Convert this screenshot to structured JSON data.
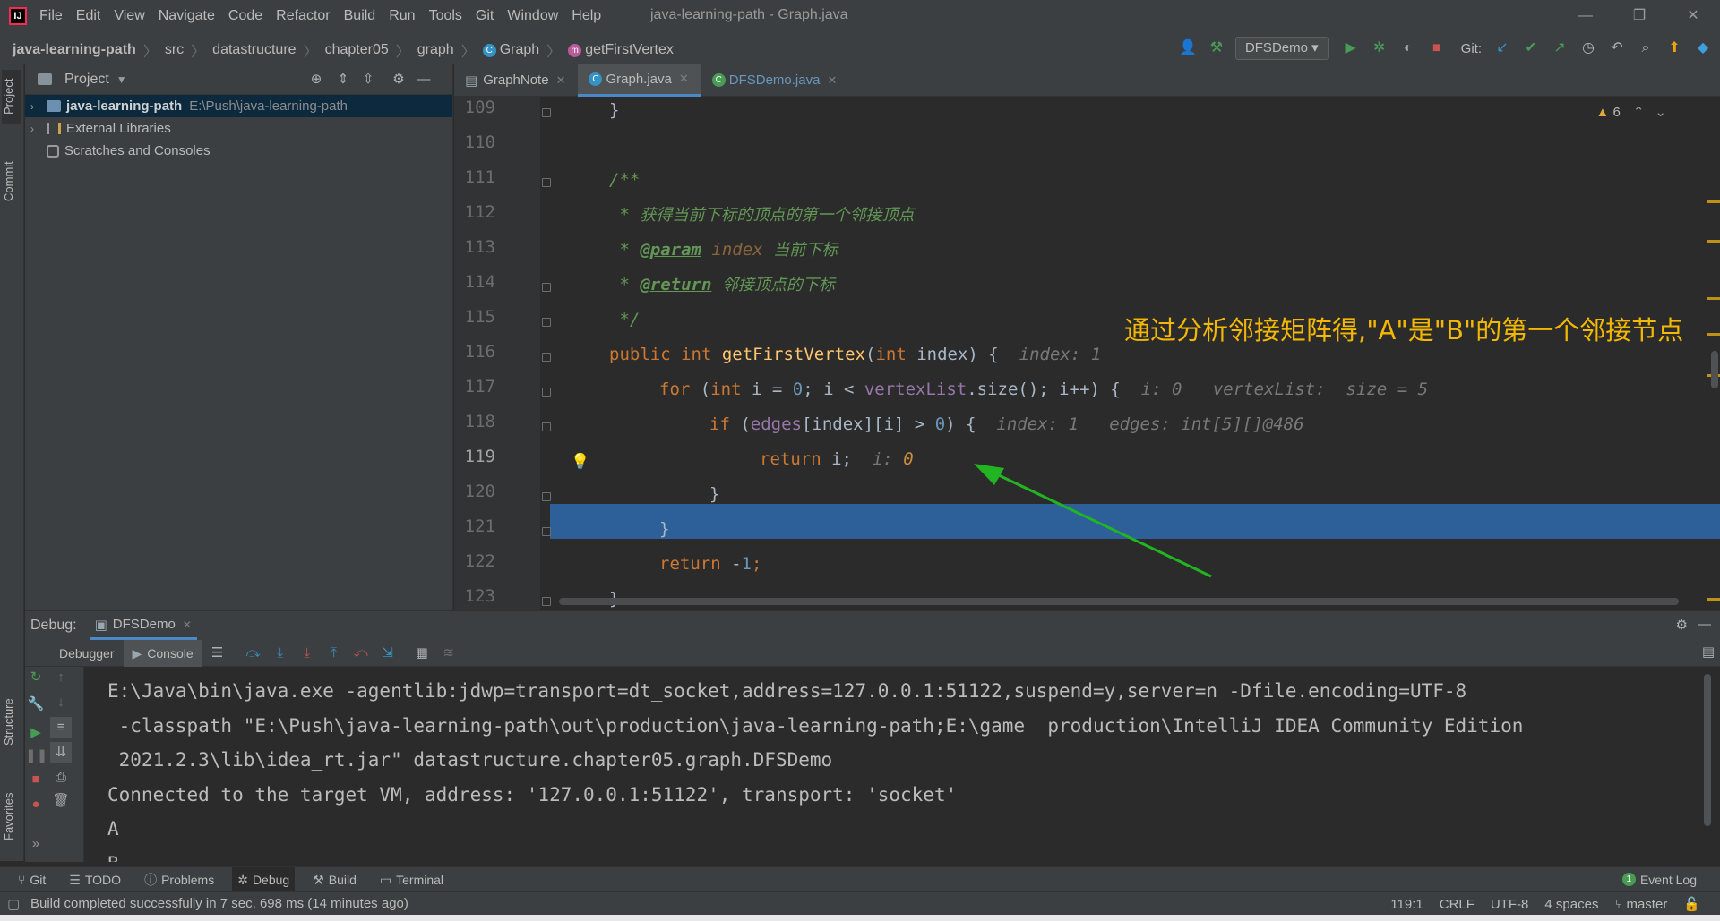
{
  "app": {
    "logo_text": "IJ",
    "window_title": "java-learning-path - Graph.java",
    "menu": [
      "File",
      "Edit",
      "View",
      "Navigate",
      "Code",
      "Refactor",
      "Build",
      "Run",
      "Tools",
      "Git",
      "Window",
      "Help"
    ],
    "window_controls": [
      "—",
      "❐",
      "✕"
    ]
  },
  "navbar": {
    "breadcrumb": {
      "project": "java-learning-path",
      "src": "src",
      "pkg1": "datastructure",
      "pkg2": "chapter05",
      "pkg3": "graph",
      "class": "Graph",
      "method": "getFirstVertex"
    },
    "run_config": "DFSDemo",
    "git_label": "Git:"
  },
  "left_stripe": {
    "project": "Project",
    "commit": "Commit",
    "structure": "Structure",
    "favorites": "Favorites"
  },
  "project_panel": {
    "title": "Project",
    "items": [
      {
        "label": "java-learning-path",
        "path": "E:\\Push\\java-learning-path"
      },
      {
        "label": "External Libraries"
      },
      {
        "label": "Scratches and Consoles"
      }
    ]
  },
  "editor": {
    "tabs": [
      {
        "label": "GraphNote"
      },
      {
        "label": "Graph.java"
      },
      {
        "label": "DFSDemo.java"
      }
    ],
    "warnings": "6",
    "line_numbers": [
      "109",
      "110",
      "111",
      "112",
      "113",
      "114",
      "115",
      "116",
      "117",
      "118",
      "119",
      "120",
      "121",
      "122",
      "123"
    ],
    "code": {
      "l109": "}",
      "l111": "/**",
      "l112_star": " * ",
      "l112_text": "获得当前下标的顶点的第一个邻接顶点",
      "l113_star": " * ",
      "l113_tag": "@param",
      "l113_param": "index",
      "l113_text": "当前下标",
      "l114_star": " * ",
      "l114_tag": "@return",
      "l114_text": "邻接顶点的下标",
      "l115": " */",
      "l116_mod": "public int ",
      "l116_fn": "getFirstVertex",
      "l116_p1": "(",
      "l116_kw": "int",
      "l116_p2": " index) {",
      "l116_hint": "index: 1",
      "l117_kw1": "for",
      "l117_a": " (",
      "l117_kw2": "int",
      "l117_b": " i = ",
      "l117_n0": "0",
      "l117_c": "; i < ",
      "l117_fld": "vertexList",
      "l117_d": ".size(); i++) {",
      "l117_hint1": "i: 0",
      "l117_hint2": "vertexList:  size = 5",
      "l118_kw": "if",
      "l118_a": " (",
      "l118_fld": "edges",
      "l118_b": "[index][i] > ",
      "l118_n0": "0",
      "l118_c": ") {",
      "l118_hint1": "index: 1",
      "l118_hint2": "edges: int[5][]@486",
      "l119_kw": "return",
      "l119_a": " i;",
      "l119_hint_k": "i: ",
      "l119_hint_v": "0",
      "l120": "}",
      "l121": "}",
      "l122_kw": "return",
      "l122_a": " -",
      "l122_n": "1",
      "l122_b": ";",
      "l123": "}"
    },
    "annotation": "通过分析邻接矩阵得,\"A\"是\"B\"的第一个邻接节点"
  },
  "debug": {
    "label": "Debug:",
    "session": "DFSDemo",
    "tabs": {
      "debugger": "Debugger",
      "console": "Console"
    },
    "console_lines": [
      "E:\\Java\\bin\\java.exe -agentlib:jdwp=transport=dt_socket,address=127.0.0.1:51122,suspend=y,server=n -Dfile.encoding=UTF-8",
      " -classpath \"E:\\Push\\java-learning-path\\out\\production\\java-learning-path;E:\\game  production\\IntelliJ IDEA Community Edition",
      " 2021.2.3\\lib\\idea_rt.jar\" datastructure.chapter05.graph.DFSDemo",
      "Connected to the target VM, address: '127.0.0.1:51122', transport: 'socket'",
      "A",
      "B"
    ]
  },
  "bottom_tabs": [
    "Git",
    "TODO",
    "Problems",
    "Debug",
    "Build",
    "Terminal"
  ],
  "event_log": "Event Log",
  "event_log_count": "1",
  "status": {
    "message": "Build completed successfully in 7 sec, 698 ms (14 minutes ago)",
    "position": "119:1",
    "line_sep": "CRLF",
    "encoding": "UTF-8",
    "indent": "4 spaces",
    "branch": "master"
  }
}
